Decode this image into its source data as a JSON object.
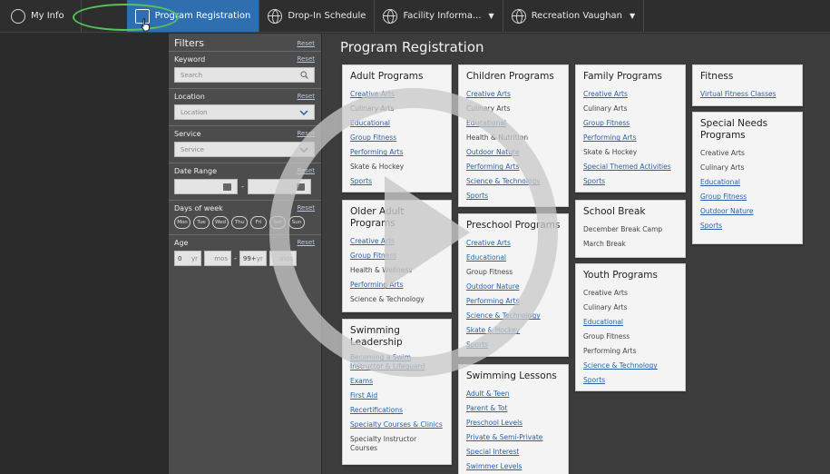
{
  "nav": {
    "tabs": [
      {
        "label": "My Info"
      },
      {
        "label": "Program Registration"
      },
      {
        "label": "Drop-In Schedule"
      },
      {
        "label": "Facility Informa..."
      },
      {
        "label": "Recreation Vaughan"
      }
    ]
  },
  "filters": {
    "title": "Filters",
    "reset": "Reset",
    "keyword": {
      "label": "Keyword",
      "placeholder": "Search"
    },
    "location": {
      "label": "Location",
      "value": "Location"
    },
    "service": {
      "label": "Service",
      "value": "Service"
    },
    "date_range": {
      "label": "Date Range",
      "sep": "-"
    },
    "days_of_week": {
      "label": "Days of week",
      "days": [
        "Mon",
        "Tue",
        "Wed",
        "Thu",
        "Fri",
        "Sat",
        "Sun"
      ]
    },
    "age": {
      "label": "Age",
      "from_yr": "0",
      "yr": "yr",
      "mos": "mos",
      "sep": "-",
      "to_yr": "99+"
    }
  },
  "main": {
    "title": "Program Registration",
    "cards": {
      "adult": {
        "title": "Adult Programs",
        "items": [
          "Creative Arts",
          "Culinary Arts",
          "Educational",
          "Group Fitness",
          "Performing Arts",
          "Skate & Hockey",
          "Sports"
        ]
      },
      "children": {
        "title": "Children Programs",
        "items": [
          "Creative Arts",
          "Culinary Arts",
          "Educational",
          "Health & Nutrition",
          "Outdoor Nature",
          "Performing Arts",
          "Science & Technology",
          "Sports"
        ]
      },
      "family": {
        "title": "Family Programs",
        "items": [
          "Creative Arts",
          "Culinary Arts",
          "Group Fitness",
          "Performing Arts",
          "Skate & Hockey",
          "Special Themed Activities",
          "Sports"
        ]
      },
      "fitness": {
        "title": "Fitness",
        "items": [
          "Virtual Fitness Classes"
        ]
      },
      "special_needs": {
        "title": "Special Needs Programs",
        "items": [
          "Creative Arts",
          "Culinary Arts",
          "Educational",
          "Group Fitness",
          "Outdoor Nature",
          "Sports"
        ]
      },
      "older_adult": {
        "title": "Older Adult Programs",
        "items": [
          "Creative Arts",
          "Group Fitness",
          "Health & Wellness",
          "Performing Arts",
          "Science & Technology"
        ]
      },
      "preschool": {
        "title": "Preschool Programs",
        "items": [
          "Creative Arts",
          "Educational",
          "Group Fitness",
          "Outdoor Nature",
          "Performing Arts",
          "Science & Technology",
          "Skate & Hockey",
          "Sports"
        ]
      },
      "school_break": {
        "title": "School Break",
        "items": [
          "December Break Camp",
          "March Break"
        ]
      },
      "youth": {
        "title": "Youth Programs",
        "items": [
          "Creative Arts",
          "Culinary Arts",
          "Educational",
          "Group Fitness",
          "Performing Arts",
          "Science & Technology",
          "Sports"
        ]
      },
      "swim_leadership": {
        "title": "Swimming Leadership",
        "items": [
          "Becoming a Swim Instructor & Lifeguard",
          "Exams",
          "First Aid",
          "Recertifications",
          "Specialty Courses & Clinics",
          "Specialty Instructor Courses"
        ]
      },
      "swim_lessons": {
        "title": "Swimming Lessons",
        "items": [
          "Adult & Teen",
          "Parent & Tot",
          "Preschool Levels",
          "Private & Semi-Private",
          "Special Interest",
          "Swimmer Levels"
        ]
      }
    }
  }
}
